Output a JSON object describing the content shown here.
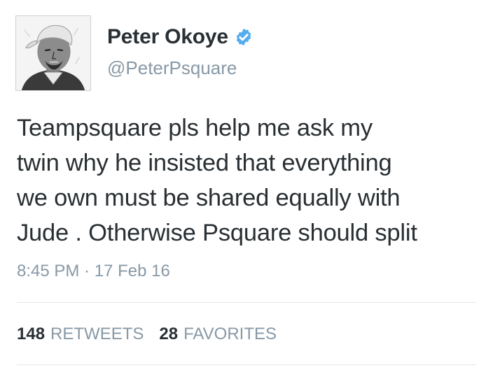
{
  "user": {
    "display_name": "Peter Okoye",
    "handle": "@PeterPsquare",
    "verified_icon": "verified-badge-icon",
    "verified_color": "#55acee"
  },
  "tweet": {
    "text": "Teampsquare pls help me ask my twin why he insisted that everything we own must be shared equally with Jude . Otherwise Psquare should split",
    "lines": [
      "Teampsquare pls help me ask my",
      "twin why he insisted that everything",
      "we own must be shared equally with",
      "Jude . Otherwise Psquare should split"
    ],
    "timestamp": "8:45 PM · 17 Feb 16"
  },
  "stats": {
    "retweets_count": "148",
    "retweets_label": "RETWEETS",
    "favorites_count": "28",
    "favorites_label": "FAVORITES"
  },
  "colors": {
    "text": "#292f33",
    "muted": "#8899a6",
    "divider": "#e1e8ed"
  }
}
